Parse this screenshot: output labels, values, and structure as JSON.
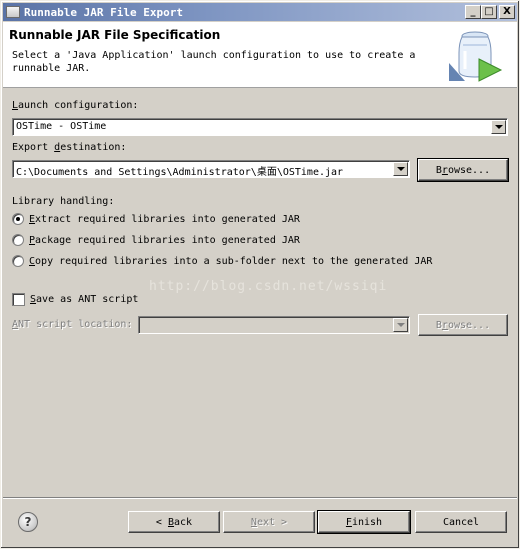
{
  "window": {
    "title": "Runnable JAR File Export",
    "minimize": "_",
    "maximize": "□",
    "close": "X"
  },
  "header": {
    "title": "Runnable JAR File Specification",
    "description": "Select a 'Java Application' launch configuration to use to create a\nrunnable JAR."
  },
  "launch": {
    "label_prefix": "",
    "label_mnemonic": "L",
    "label_rest": "aunch configuration:",
    "value": "OSTime - OSTime"
  },
  "export": {
    "label_prefix": "Export ",
    "label_mnemonic": "d",
    "label_rest": "estination:",
    "value": "C:\\Documents and Settings\\Administrator\\桌面\\OSTime.jar",
    "browse_mnemonic": "r",
    "browse_pre": "B",
    "browse_post": "owse..."
  },
  "library": {
    "label": "Library handling:",
    "options": [
      {
        "mnemonic": "E",
        "rest": "xtract required libraries into generated JAR",
        "selected": true
      },
      {
        "mnemonic": "P",
        "rest": "ackage required libraries into generated JAR",
        "selected": false
      },
      {
        "mnemonic": "C",
        "rest": "opy required libraries into a sub-folder next to the generated JAR",
        "selected": false
      }
    ]
  },
  "ant": {
    "checkbox_mnemonic": "S",
    "checkbox_rest": "ave as ANT script",
    "checked": false,
    "location_mnemonic": "A",
    "location_rest": "NT script location:",
    "value": "",
    "browse_pre": "B",
    "browse_mnemonic": "r",
    "browse_post": "owse..."
  },
  "watermark": "http://blog.csdn.net/wssiqi",
  "buttons": {
    "help": "?",
    "back_arrow": "<",
    "back_mnemonic": "B",
    "back_rest": "ack",
    "next_mnemonic": "N",
    "next_rest": "ext",
    "next_arrow": ">",
    "finish_mnemonic": "F",
    "finish_rest": "inish",
    "cancel": "Cancel"
  }
}
